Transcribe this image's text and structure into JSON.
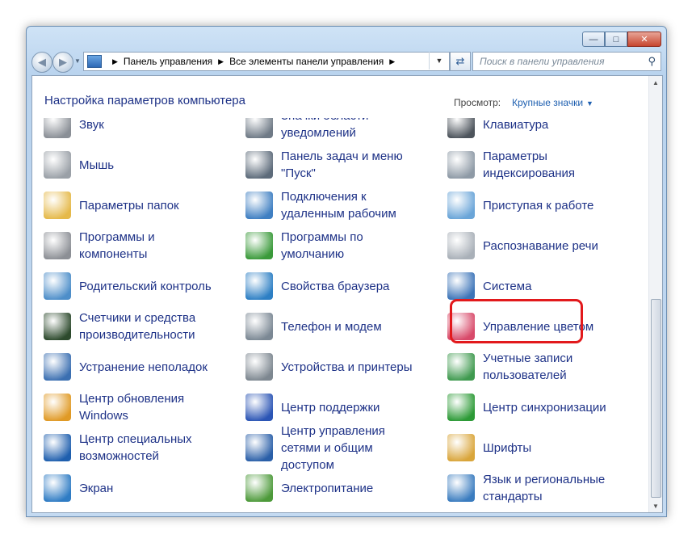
{
  "window": {
    "caption_minimize": "—",
    "caption_maximize": "□",
    "caption_close": "✕"
  },
  "nav": {
    "back": "◀",
    "forward": "▶",
    "breadcrumb": [
      "Панель управления",
      "Все элементы панели управления"
    ],
    "separator": "▶",
    "search_placeholder": "Поиск в панели управления"
  },
  "header": {
    "title": "Настройка параметров компьютера",
    "view_label": "Просмотр:",
    "view_value": "Крупные значки"
  },
  "items": [
    {
      "label": "Звук",
      "icon": "speaker-icon",
      "color": "#8a8f96"
    },
    {
      "label": "Значки области уведомлений",
      "icon": "notification-area-icon",
      "color": "#6f7a86"
    },
    {
      "label": "Клавиатура",
      "icon": "keyboard-icon",
      "color": "#4d545c"
    },
    {
      "label": "Мышь",
      "icon": "mouse-icon",
      "color": "#9aa0a7"
    },
    {
      "label": "Панель задач и меню \"Пуск\"",
      "icon": "taskbar-icon",
      "color": "#5d6b7a"
    },
    {
      "label": "Параметры индексирования",
      "icon": "indexing-icon",
      "color": "#8e9aa6"
    },
    {
      "label": "Параметры папок",
      "icon": "folder-options-icon",
      "color": "#e5b94a"
    },
    {
      "label": "Подключения к удаленным рабочим",
      "icon": "remote-connections-icon",
      "color": "#3f7fc2"
    },
    {
      "label": "Приступая к работе",
      "icon": "getting-started-icon",
      "color": "#6aa5d8"
    },
    {
      "label": "Программы и компоненты",
      "icon": "programs-icon",
      "color": "#8c8f95"
    },
    {
      "label": "Программы по умолчанию",
      "icon": "default-programs-icon",
      "color": "#3a9a3a"
    },
    {
      "label": "Распознавание речи",
      "icon": "microphone-icon",
      "color": "#a9b0b8"
    },
    {
      "label": "Родительский контроль",
      "icon": "parental-control-icon",
      "color": "#4d8ec9"
    },
    {
      "label": "Свойства браузера",
      "icon": "internet-options-icon",
      "color": "#2d7fc4"
    },
    {
      "label": "Система",
      "icon": "system-icon",
      "color": "#3c74b8"
    },
    {
      "label": "Счетчики и средства производительности",
      "icon": "performance-icon",
      "color": "#2d4a2d"
    },
    {
      "label": "Телефон и модем",
      "icon": "phone-modem-icon",
      "color": "#7b8894"
    },
    {
      "label": "Управление цветом",
      "icon": "color-management-icon",
      "color": "#d84a6a"
    },
    {
      "label": "Устранение неполадок",
      "icon": "troubleshooting-icon",
      "color": "#3b6fb1"
    },
    {
      "label": "Устройства и принтеры",
      "icon": "devices-printers-icon",
      "color": "#7d8790"
    },
    {
      "label": "Учетные записи пользователей",
      "icon": "user-accounts-icon",
      "color": "#3f9a4f"
    },
    {
      "label": "Центр обновления Windows",
      "icon": "windows-update-icon",
      "color": "#e09a26"
    },
    {
      "label": "Центр поддержки",
      "icon": "action-center-icon",
      "color": "#2b55b5"
    },
    {
      "label": "Центр синхронизации",
      "icon": "sync-center-icon",
      "color": "#2c9a36"
    },
    {
      "label": "Центр специальных возможностей",
      "icon": "ease-of-access-icon",
      "color": "#1f5fae"
    },
    {
      "label": "Центр управления сетями и общим доступом",
      "icon": "network-center-icon",
      "color": "#2a5fa8"
    },
    {
      "label": "Шрифты",
      "icon": "fonts-icon",
      "color": "#d9a53a"
    },
    {
      "label": "Экран",
      "icon": "display-icon",
      "color": "#2f7cc4"
    },
    {
      "label": "Электропитание",
      "icon": "power-options-icon",
      "color": "#4d9a3a"
    },
    {
      "label": "Язык и региональные стандарты",
      "icon": "region-language-icon",
      "color": "#3a7cbf"
    }
  ]
}
